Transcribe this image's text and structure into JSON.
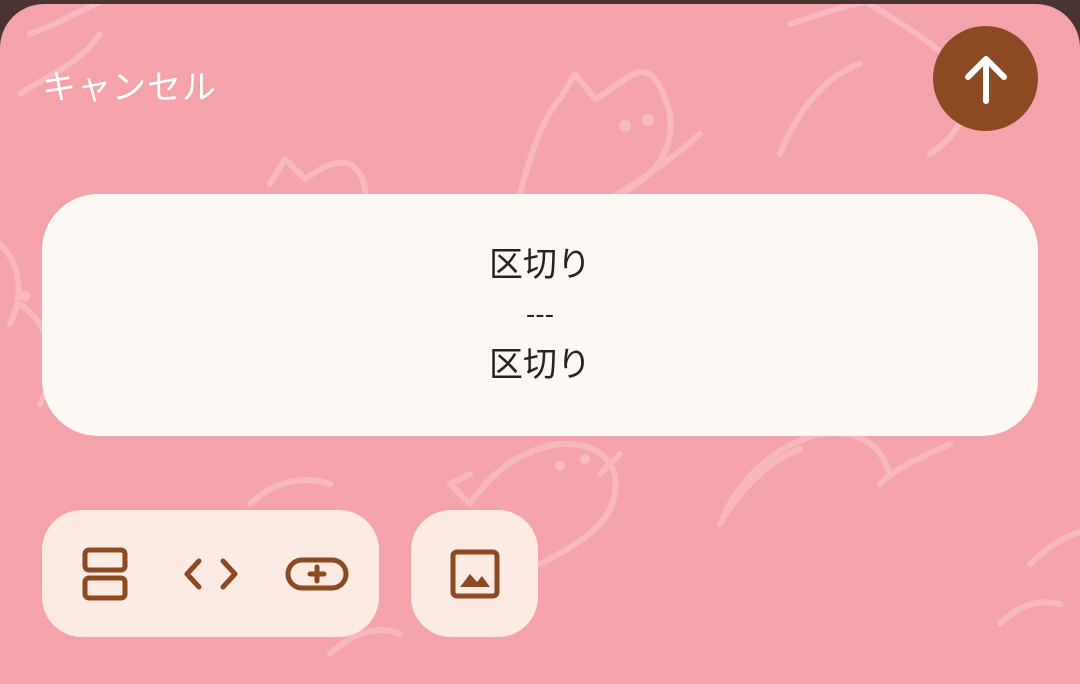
{
  "header": {
    "cancel_label": "キャンセル",
    "send_icon": "arrow-up-icon"
  },
  "preview": {
    "line1": "区切り",
    "separator": "---",
    "line2": "区切り"
  },
  "toolbar": {
    "tools": [
      {
        "icon": "split-view-icon"
      },
      {
        "icon": "code-brackets-icon"
      },
      {
        "icon": "add-button-icon"
      }
    ],
    "image_tool": {
      "icon": "image-icon"
    }
  },
  "colors": {
    "background": "#f4a3aa",
    "accent": "#8b4a22",
    "card": "#fdf8f4",
    "toolbar": "#fdebe3",
    "text": "#2a2220"
  }
}
